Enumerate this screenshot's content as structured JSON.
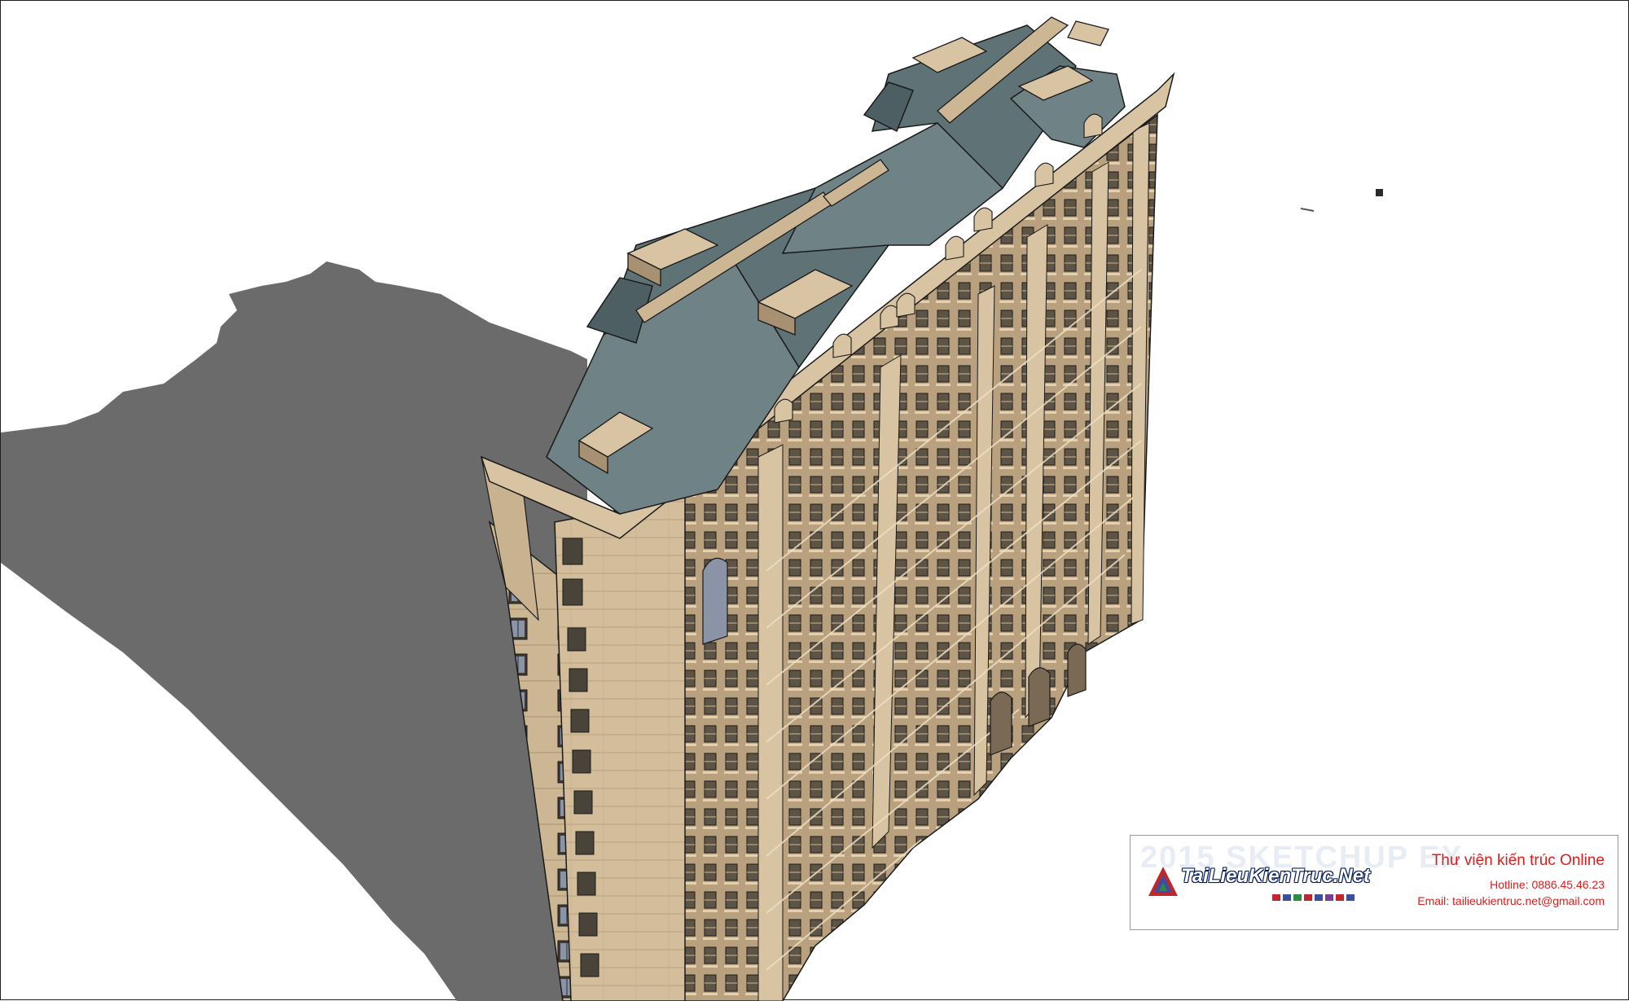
{
  "viewport": {
    "background": "#ffffff",
    "model": "classical high-rise residential tower with mansard roofs"
  },
  "colors": {
    "shadow": "#6b6b6b",
    "facade_light": "#d8c3a2",
    "facade_mid": "#b59d7b",
    "facade_dark": "#8c7658",
    "roof": "#6f8286",
    "roof_dark": "#4e5f63",
    "glass": "#8b93a6",
    "edge": "#1a1a1a"
  },
  "watermark": {
    "ghost_text": "2015 SKETCHUP EX",
    "brand": "TaiLieuKienTruc.Net",
    "title": "Thư viện kiến trúc Online",
    "hotline": "Hotline: 0886.45.46.23",
    "email": "Email: tailieukientruc.net@gmail.com",
    "accent_color": "#e01b1b",
    "swatch_colors": [
      "#c0262d",
      "#3b4fa0",
      "#2d8c3e",
      "#c0262d",
      "#3b4fa0",
      "#7a3f90",
      "#c0262d",
      "#3b4fa0"
    ]
  }
}
